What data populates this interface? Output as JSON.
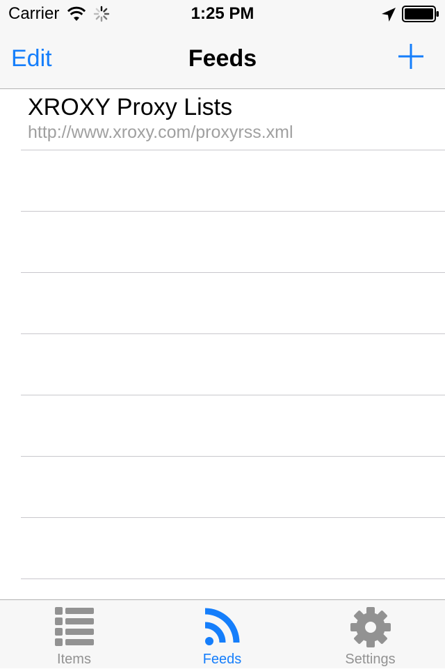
{
  "status_bar": {
    "carrier": "Carrier",
    "time": "1:25 PM",
    "icons": [
      "wifi-icon",
      "activity-spinner-icon",
      "location-arrow-icon",
      "battery-icon"
    ]
  },
  "nav": {
    "left_label": "Edit",
    "title": "Feeds",
    "right_icon": "plus-icon"
  },
  "feeds": [
    {
      "title": "XROXY Proxy Lists",
      "url": "http://www.xroxy.com/proxyrss.xml"
    }
  ],
  "tabs": [
    {
      "label": "Items",
      "icon": "list-icon",
      "active": false
    },
    {
      "label": "Feeds",
      "icon": "rss-icon",
      "active": true
    },
    {
      "label": "Settings",
      "icon": "gear-icon",
      "active": false
    }
  ],
  "colors": {
    "accent": "#157efb",
    "inactive": "#929292",
    "bar_background": "#f7f7f7",
    "separator": "#c8c7cc",
    "subtitle": "#a0a0a0"
  }
}
